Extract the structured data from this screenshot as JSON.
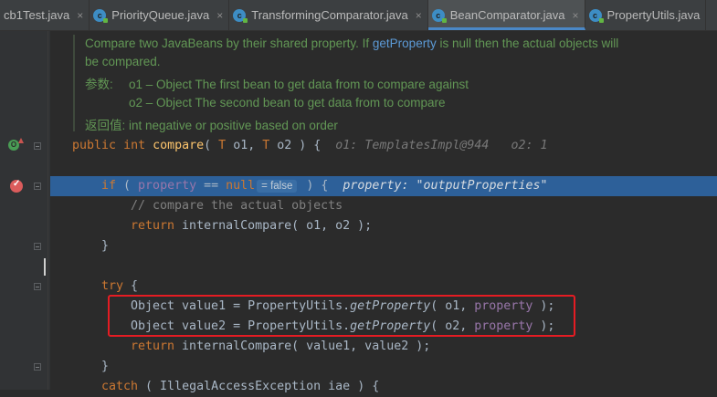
{
  "tabs": [
    {
      "label": "cb1Test.java",
      "active": false
    },
    {
      "label": "PriorityQueue.java",
      "active": false
    },
    {
      "label": "TransformingComparator.java",
      "active": false
    },
    {
      "label": "BeanComparator.java",
      "active": true
    },
    {
      "label": "PropertyUtils.java",
      "active": false
    }
  ],
  "tab_close_glyph": "×",
  "tab_icon_letter": "c",
  "doc": {
    "line1_a": "Compare two JavaBeans by their shared property. If ",
    "line1_code": "getProperty",
    "line1_b": " is null then the actual objects will",
    "line2": "be compared.",
    "params_tag": "参数:",
    "param1": "o1 – Object The first bean to get data from to compare against",
    "param2": "o2 – Object The second bean to get data from to compare",
    "returns_tag": "返回值:",
    "returns": "int negative or positive based on order"
  },
  "code": {
    "l1_public": "public",
    "l1_int": "int",
    "l1_name": "compare",
    "l1_open": "( ",
    "l1_T1": "T",
    "l1_o1": " o1, ",
    "l1_T2": "T",
    "l1_o2": " o2 ) {",
    "l1_hint1": "o1: TemplatesImpl@944",
    "l1_hint2": "o2: 1",
    "l2_if": "if",
    "l2_open": " ( ",
    "l2_property": "property",
    "l2_eq": " == ",
    "l2_null": "null",
    "l2_inlay": "= false",
    "l2_close": " ) {",
    "l2_hint": "property: \"outputProperties\"",
    "l3_comment": "// compare the actual objects",
    "l4_return": "return",
    "l4_call": " internalCompare( o1, o2 );",
    "l5_brace": "}",
    "l7_try": "try",
    "l7_brace": " {",
    "l8_a": "Object value1 = PropertyUtils.",
    "l8_method": "getProperty",
    "l8_b": "( o1, ",
    "l8_prop": "property",
    "l8_c": " );",
    "l9_a": "Object value2 = PropertyUtils.",
    "l9_method": "getProperty",
    "l9_b": "( o2, ",
    "l9_prop": "property",
    "l9_c": " );",
    "l10_return": "return",
    "l10_call": " internalCompare( value1, value2 );",
    "l11_brace": "}",
    "l12_catch": "catch",
    "l12_rest": " ( IllegalAccessException iae ) {"
  },
  "icon_names": {
    "override": "override-gutter-icon",
    "breakpoint": "breakpoint-icon",
    "fold": "fold-icon"
  },
  "colors": {
    "execution_line": "#2d6099",
    "highlight_box": "#e51c23",
    "active_tab_underline": "#4a88c7"
  }
}
